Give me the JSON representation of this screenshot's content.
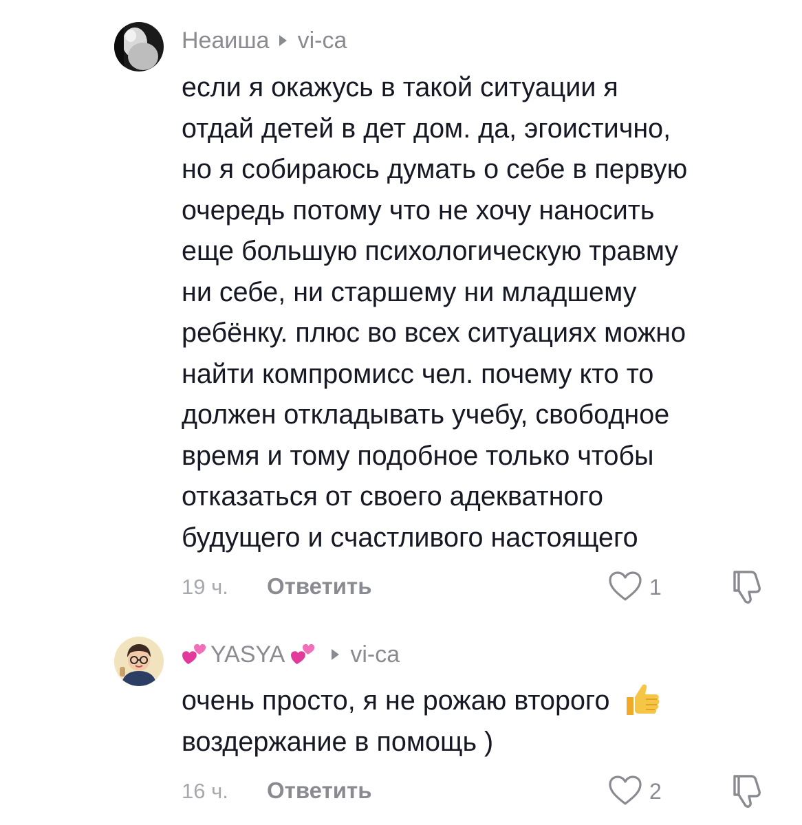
{
  "comments": [
    {
      "username": "Неаиша",
      "reply_to": "vi-ca",
      "text_lines": [
        "если я окажусь в такой ситуации я",
        "отдай детей в дет дом. да, эгоистично,",
        "но я собираюсь думать о себе в первую",
        "очередь потому что не хочу наносить",
        "еще большую психологическую травму",
        "ни себе, ни старшему ни младшему",
        "ребёнку. плюс во всех ситуациях можно",
        "найти компромисс чел. почему кто то",
        "должен откладывать учебу, свободное",
        "время и тому подобное только чтобы",
        "отказаться от своего адекватного",
        "будущего и счастливого настоящего"
      ],
      "time": "19 ч.",
      "reply_label": "Ответить",
      "likes": "1"
    },
    {
      "username": "YASYA",
      "reply_to": "vi-ca",
      "text_lines": [
        "очень просто, я не рожаю второго",
        "воздержание в помощь )"
      ],
      "time": "16 ч.",
      "reply_label": "Ответить",
      "likes": "2"
    }
  ],
  "icons": {
    "like": "heart-outline-icon",
    "dislike": "thumbs-down-outline-icon",
    "arrow": "reply-arrow-icon",
    "emoji_heart": "two-hearts-emoji",
    "emoji_thumb": "thumbs-up-emoji"
  },
  "colors": {
    "text": "#161823",
    "muted": "#8a8b91",
    "time": "#a7a8ad",
    "emoji_heart": "#e23a9a",
    "emoji_thumb": "#f4b73a"
  }
}
